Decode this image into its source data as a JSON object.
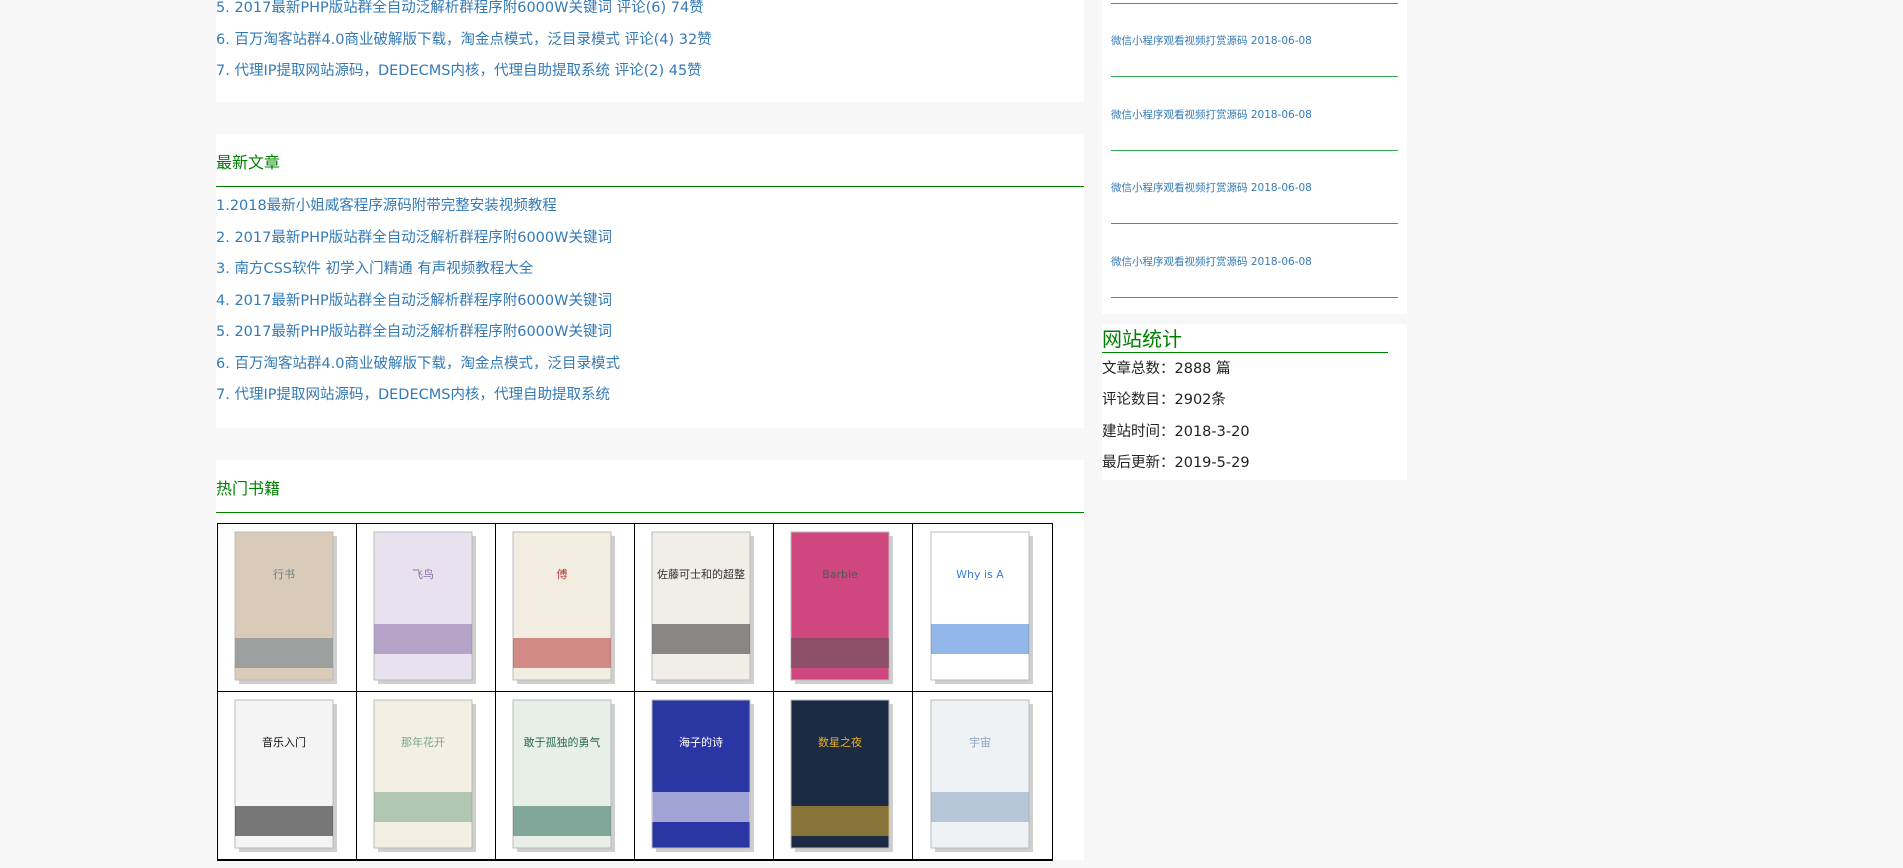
{
  "hot_list": [
    "5. 2017最新PHP版站群全自动泛解析群程序附6000W关键词 评论(6) 74赞",
    "6. 百万淘客站群4.0商业破解版下载，淘金点模式，泛目录模式 评论(4) 32赞",
    "7. 代理IP提取网站源码，DEDECMS内核，代理自助提取系统 评论(2) 45赞"
  ],
  "latest": {
    "title": "最新文章",
    "items": [
      "1.2018最新小姐威客程序源码附带完整安装视频教程",
      "2. 2017最新PHP版站群全自动泛解析群程序附6000W关键词",
      "3. 南方CSS软件 初学入门精通 有声视频教程大全",
      "4. 2017最新PHP版站群全自动泛解析群程序附6000W关键词",
      "5. 2017最新PHP版站群全自动泛解析群程序附6000W关键词",
      "6. 百万淘客站群4.0商业破解版下载，淘金点模式，泛目录模式",
      "7. 代理IP提取网站源码，DEDECMS内核，代理自助提取系统"
    ]
  },
  "books": {
    "title": "热门书籍",
    "covers": [
      {
        "title": "行书",
        "color": "#d9cbb8",
        "accent": "#6a7d8a"
      },
      {
        "title": "飞鸟",
        "color": "#e8e2ef",
        "accent": "#8a6fa8"
      },
      {
        "title": "傅",
        "color": "#f3ece1",
        "accent": "#b43a3a"
      },
      {
        "title": "佐藤可士和的超整理术",
        "color": "#f1eee8",
        "accent": "#333333"
      },
      {
        "title": "Barbie",
        "color": "#d0467f",
        "accent": "#555555"
      },
      {
        "title": "Why is Art?",
        "color": "#ffffff",
        "accent": "#3a7bd5"
      },
      {
        "title": "音乐入门",
        "color": "#f4f4f4",
        "accent": "#111111"
      },
      {
        "title": "那年花开",
        "color": "#f3efe2",
        "accent": "#7aa68a"
      },
      {
        "title": "敢于孤独的勇气",
        "color": "#e7efe7",
        "accent": "#2d6b5b"
      },
      {
        "title": "海子的诗",
        "color": "#2a36a3",
        "accent": "#ffffff"
      },
      {
        "title": "数星之夜",
        "color": "#1c2a44",
        "accent": "#e0b030"
      },
      {
        "title": "宇宙",
        "color": "#eef2f5",
        "accent": "#8aa3bb"
      }
    ]
  },
  "recent_posts": [
    "微信小程序观看视频打赏源码 2018-06-08",
    "微信小程序观看视频打赏源码 2018-06-08",
    "微信小程序观看视频打赏源码 2018-06-08",
    "微信小程序观看视频打赏源码 2018-06-08"
  ],
  "stats": {
    "title": "网站统计",
    "rows": [
      {
        "label": "文章总数：",
        "value": "2888 篇"
      },
      {
        "label": "评论数目：",
        "value": "2902条"
      },
      {
        "label": "建站时间：",
        "value": "2018-3-20"
      },
      {
        "label": "最后更新：",
        "value": "2019-5-29"
      }
    ]
  }
}
